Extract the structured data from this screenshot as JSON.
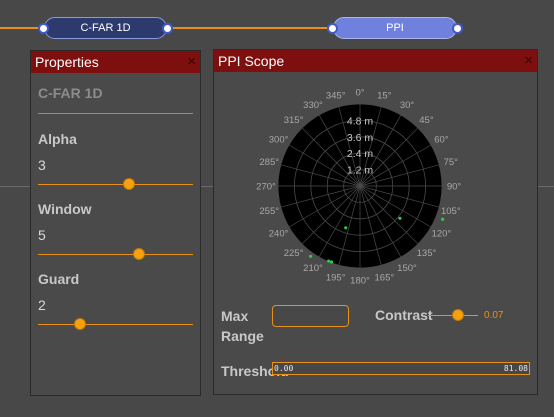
{
  "nodes": {
    "cfar": "C-FAR 1D",
    "ppi": "PPI"
  },
  "properties": {
    "title": "Properties",
    "close": "×",
    "node_name": "C-FAR 1D",
    "fields": [
      {
        "label": "Alpha",
        "value": "3",
        "slider_fraction": 0.59
      },
      {
        "label": "Window",
        "value": "5",
        "slider_fraction": 0.65
      },
      {
        "label": "Guard",
        "value": "2",
        "slider_fraction": 0.27
      }
    ]
  },
  "ppi_scope": {
    "title": "PPI Scope",
    "close": "×",
    "range_rings": [
      "1.2 m",
      "2.4 m",
      "3.6 m",
      "4.8 m"
    ],
    "bearing_labels": [
      "0°",
      "15°",
      "30°",
      "45°",
      "60°",
      "75°",
      "90°",
      "105°",
      "120°",
      "135°",
      "150°",
      "165°",
      "180°",
      "195°",
      "210°",
      "225°",
      "240°",
      "255°",
      "270°",
      "285°",
      "300°",
      "315°",
      "330°",
      "345°"
    ],
    "max_range_label": "Max Range",
    "max_range_line1": "Max",
    "max_range_line2": "Range",
    "max_range_value": "",
    "contrast_label": "Contrast",
    "contrast_value": "0.07",
    "contrast_fraction": 0.6,
    "threshold_label": "Threshold",
    "threshold_min": "0.00",
    "threshold_max": "81.08"
  },
  "colors": {
    "accent": "#e8901a",
    "panel_header": "#7e0f0f",
    "scope_bg": "#000000",
    "targets": "#2ecc40",
    "node_selected": "#2c3a6e",
    "node_ppi": "#6f80dd"
  }
}
